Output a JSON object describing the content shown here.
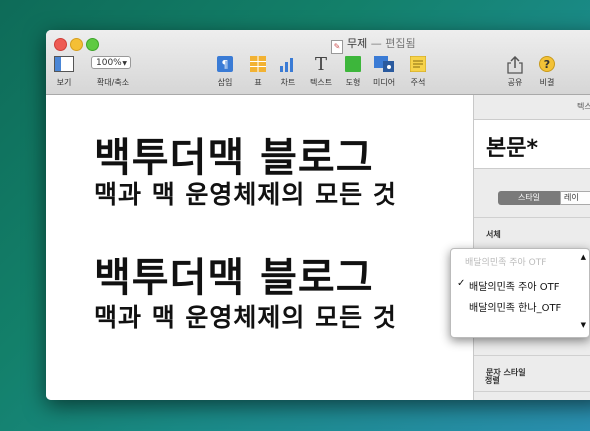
{
  "window": {
    "title": "무제",
    "subtitle": "— 편집됨"
  },
  "toolbar": {
    "view_label": "보기",
    "zoom_value": "100%",
    "zoom_label": "확대/축소",
    "insert_label": "삽입",
    "table_label": "표",
    "chart_label": "차트",
    "text_label": "텍스트",
    "shape_label": "도형",
    "media_label": "미디어",
    "comment_label": "주석",
    "share_label": "공유",
    "tips_label": "비결"
  },
  "document": {
    "line1": "백투더맥 블로그",
    "line2": "맥과 맥 운영체제의 모든 것",
    "line3": "백투더맥 블로그",
    "line4": "맥과 맥 운영체제의 모든 것"
  },
  "inspector": {
    "tab_label": "텍스",
    "paragraph_style": "본문*",
    "seg_style": "스타일",
    "seg_layout": "레이",
    "font_label": "서체",
    "char_style_label": "문자 스타일",
    "align_label": "정렬"
  },
  "font_menu": {
    "faded_text": "배달의민족 주아 OTF",
    "options": [
      "배달의민족 주아 OTF",
      "배달의민족 한나_OTF"
    ],
    "selected": "배달의민족 주아 OTF"
  },
  "colors": {
    "close": "#ee5b53",
    "minimize": "#f4bf35",
    "maximize": "#5fca42",
    "insert_blue": "#3a7bd5",
    "table_orange": "#f2b233",
    "shape_green": "#3db63b",
    "tips_yellow": "#f3c237"
  }
}
